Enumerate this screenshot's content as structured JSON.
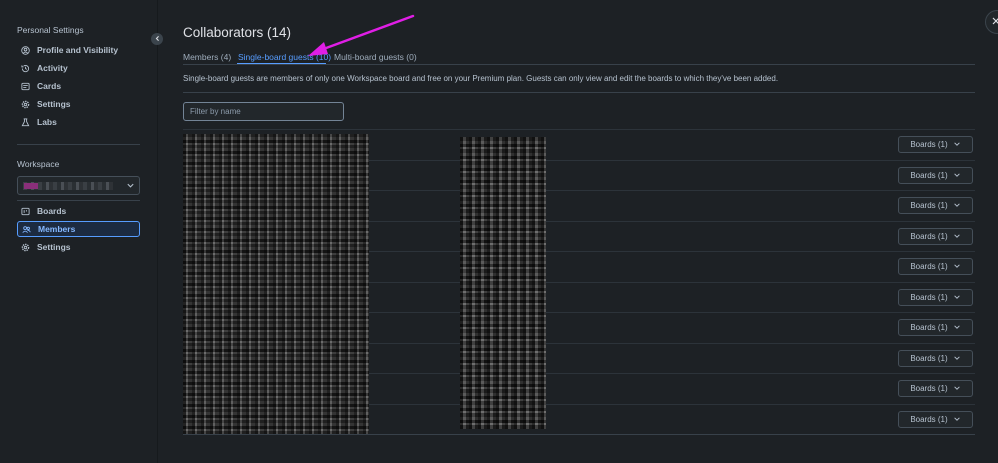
{
  "sidebar": {
    "personal_heading": "Personal Settings",
    "personal_items": [
      {
        "label": "Profile and Visibility",
        "icon": "user-circle-icon"
      },
      {
        "label": "Activity",
        "icon": "history-icon"
      },
      {
        "label": "Cards",
        "icon": "card-icon"
      },
      {
        "label": "Settings",
        "icon": "gear-icon"
      },
      {
        "label": "Labs",
        "icon": "flask-icon"
      }
    ],
    "workspace_heading": "Workspace",
    "workspace_items": [
      {
        "label": "Boards",
        "icon": "boards-icon"
      },
      {
        "label": "Members",
        "icon": "members-icon",
        "active": true
      },
      {
        "label": "Settings",
        "icon": "gear-icon"
      }
    ]
  },
  "main": {
    "title": "Collaborators (14)",
    "tabs": [
      {
        "label": "Members (4)"
      },
      {
        "label": "Single-board guests (10)",
        "active": true
      },
      {
        "label": "Multi-board guests (0)"
      }
    ],
    "description": "Single-board guests are members of only one Workspace board and free on your Premium plan. Guests can only view and edit the boards to which they've been added.",
    "filter_placeholder": "Filter by name",
    "rows": [
      {
        "boards_label": "Boards (1)"
      },
      {
        "boards_label": "Boards (1)"
      },
      {
        "boards_label": "Boards (1)"
      },
      {
        "boards_label": "Boards (1)"
      },
      {
        "boards_label": "Boards (1)"
      },
      {
        "boards_label": "Boards (1)"
      },
      {
        "boards_label": "Boards (1)"
      },
      {
        "boards_label": "Boards (1)"
      },
      {
        "boards_label": "Boards (1)"
      },
      {
        "boards_label": "Boards (1)"
      }
    ]
  },
  "colors": {
    "background": "#1d2125",
    "accent": "#579dff",
    "annotation_arrow": "#e01ee6"
  }
}
